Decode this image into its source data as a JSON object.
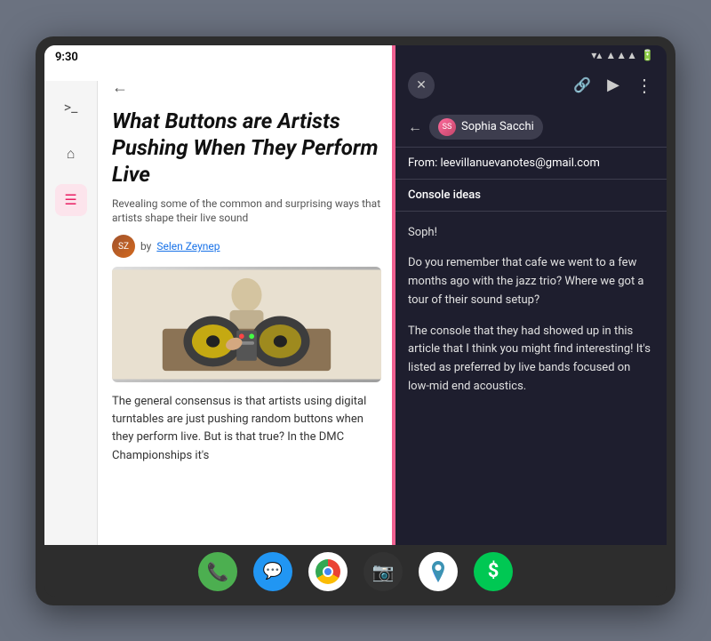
{
  "device": {
    "left_status_time": "9:30"
  },
  "left_panel": {
    "back_button": "←",
    "sidebar_icons": [
      {
        "name": "terminal-icon",
        "symbol": ">_",
        "active": false
      },
      {
        "name": "home-icon",
        "symbol": "⌂",
        "active": false
      },
      {
        "name": "list-icon",
        "symbol": "≡",
        "active": true
      }
    ],
    "article": {
      "title": "What Buttons are Artists Pushing When They Perform Live",
      "subtitle": "Revealing some of the common and surprising ways that artists shape their live sound",
      "author_prefix": "by",
      "author_name": "Selen Zeynep",
      "body_text": "The general consensus is that artists using digital turntables are just pushing random buttons when they perform live. But is that true? In the DMC Championships it's"
    }
  },
  "right_panel": {
    "status_bar": {
      "wifi": "▲",
      "signal": "▲▲",
      "battery": "▬"
    },
    "toolbar": {
      "close_label": "✕",
      "link_icon": "🔗",
      "send_icon": "▶",
      "more_icon": "⋮"
    },
    "email": {
      "back_arrow": "←",
      "recipient_name": "Sophia Sacchi",
      "from_label": "From:",
      "from_address": "leevillanuevanotes@gmail.com",
      "subject": "Console ideas",
      "greeting": "Soph!",
      "body_para1": "Do you remember that cafe we went to a few months ago with the jazz trio? Where we got a tour of their sound setup?",
      "body_para2": "The console that they had showed up in this article that I think you might find interesting! It's listed as preferred by live bands focused on low-mid end acoustics."
    }
  },
  "dock": {
    "icons": [
      {
        "name": "phone",
        "label": "📞"
      },
      {
        "name": "messages",
        "label": "💬"
      },
      {
        "name": "chrome",
        "label": "chrome"
      },
      {
        "name": "camera",
        "label": "📷"
      },
      {
        "name": "maps",
        "label": "maps"
      },
      {
        "name": "cash",
        "label": "$"
      }
    ]
  }
}
